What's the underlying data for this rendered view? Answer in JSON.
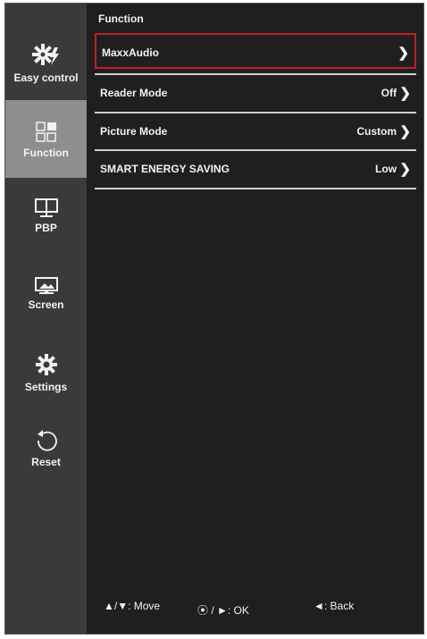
{
  "sidebar": {
    "items": [
      {
        "label": "Easy control",
        "icon": "easy-control-icon"
      },
      {
        "label": "Function",
        "icon": "function-icon"
      },
      {
        "label": "PBP",
        "icon": "pbp-icon"
      },
      {
        "label": "Screen",
        "icon": "screen-icon"
      },
      {
        "label": "Settings",
        "icon": "settings-gear-icon"
      },
      {
        "label": "Reset",
        "icon": "reset-icon"
      }
    ]
  },
  "panel": {
    "title": "Function",
    "rows": [
      {
        "label": "MaxxAudio",
        "value": ""
      },
      {
        "label": "Reader Mode",
        "value": "Off"
      },
      {
        "label": "Picture Mode",
        "value": "Custom"
      },
      {
        "label": "SMART ENERGY SAVING",
        "value": "Low"
      }
    ]
  },
  "footer": {
    "move": "▲/▼: Move",
    "ok": "⦿ / ►: OK",
    "back": "◄: Back"
  },
  "colors": {
    "background": "#1f1f1f",
    "sidebar": "#3a3a3a",
    "active": "#8e8e8e",
    "highlight": "#c0202a"
  }
}
